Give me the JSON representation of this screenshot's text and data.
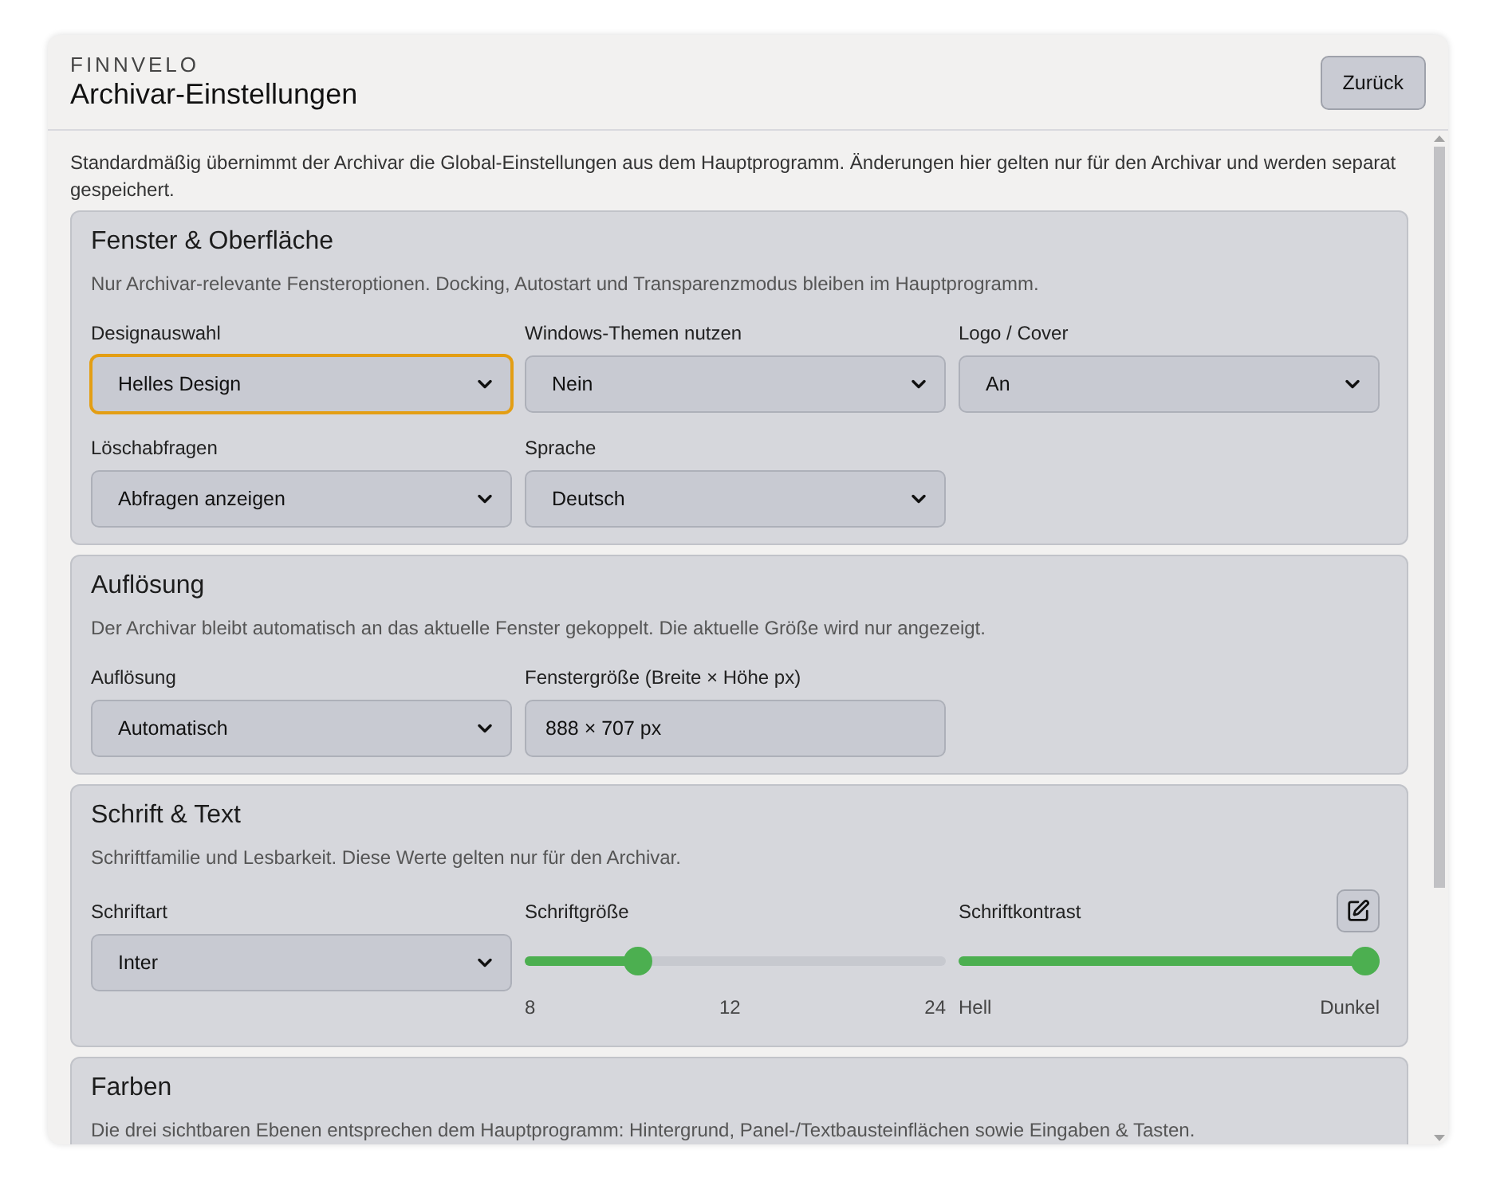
{
  "header": {
    "brand": "FINNVELO",
    "title": "Archivar-Einstellungen",
    "back_button": "Zurück"
  },
  "intro": "Standardmäßig übernimmt der Archivar die Global-Einstellungen aus dem Hauptprogramm. Änderungen hier gelten nur für den Archivar und werden separat gespeichert.",
  "sections": [
    {
      "title": "Fenster & Oberfläche",
      "description": "Nur Archivar-relevante Fensteroptionen. Docking, Autostart und Transparenzmodus bleiben im Hauptprogramm.",
      "fields": [
        {
          "kind": "select",
          "label": "Designauswahl",
          "value": "Helles Design",
          "focused": true
        },
        {
          "kind": "select",
          "label": "Windows-Themen nutzen",
          "value": "Nein",
          "focused": false
        },
        {
          "kind": "select",
          "label": "Logo / Cover",
          "value": "An",
          "focused": false
        },
        {
          "kind": "select",
          "label": "Löschabfragen",
          "value": "Abfragen anzeigen",
          "focused": false
        },
        {
          "kind": "select",
          "label": "Sprache",
          "value": "Deutsch",
          "focused": false
        }
      ]
    },
    {
      "title": "Auflösung",
      "description": "Der Archivar bleibt automatisch an das aktuelle Fenster gekoppelt. Die aktuelle Größe wird nur angezeigt.",
      "fields": [
        {
          "kind": "select",
          "label": "Auflösung",
          "value": "Automatisch",
          "focused": false
        },
        {
          "kind": "input",
          "label": "Fenstergröße (Breite × Höhe px)",
          "value": "888 × 707 px"
        }
      ]
    },
    {
      "title": "Schrift & Text",
      "description": "Schriftfamilie und Lesbarkeit. Diese Werte gelten nur für den Archivar.",
      "fields": [
        {
          "kind": "select",
          "label": "Schriftart",
          "value": "Inter",
          "focused": false
        },
        {
          "kind": "slider",
          "label": "Schriftgröße",
          "level": 0.25,
          "scale": [
            "8",
            "12",
            "24"
          ]
        },
        {
          "kind": "slider",
          "label": "Schriftkontrast",
          "level": 1,
          "scale": [
            "Hell",
            "Dunkel"
          ],
          "edit_button": true
        }
      ]
    },
    {
      "title": "Farben",
      "description": "Die drei sichtbaren Ebenen entsprechen dem Hauptprogramm: Hintergrund, Panel-/Textbausteinflächen sowie Eingaben & Tasten."
    }
  ]
}
